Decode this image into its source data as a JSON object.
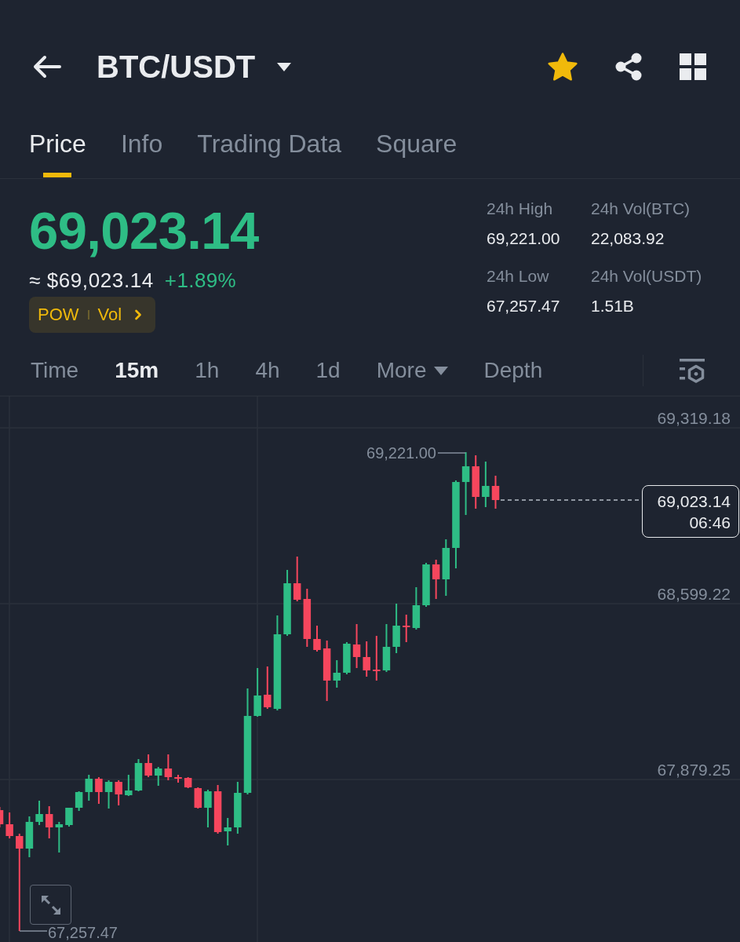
{
  "header": {
    "title": "BTC/USDT",
    "favorite": true
  },
  "tabs": [
    {
      "label": "Price",
      "selected": true
    },
    {
      "label": "Info",
      "selected": false
    },
    {
      "label": "Trading Data",
      "selected": false
    },
    {
      "label": "Square",
      "selected": false
    }
  ],
  "price": {
    "last": "69,023.14",
    "approx": "≈ $69,023.14",
    "change": "+1.89%",
    "rising": true,
    "tags": [
      "POW",
      "Vol"
    ]
  },
  "stats": [
    {
      "label": "24h High",
      "value": "69,221.00"
    },
    {
      "label": "24h Vol(BTC)",
      "value": "22,083.92"
    },
    {
      "label": "24h Low",
      "value": "67,257.47"
    },
    {
      "label": "24h Vol(USDT)",
      "value": "1.51B"
    }
  ],
  "intervals": [
    {
      "label": "Time",
      "kind": "option",
      "selected": false
    },
    {
      "label": "15m",
      "kind": "option",
      "selected": true
    },
    {
      "label": "1h",
      "kind": "option",
      "selected": false
    },
    {
      "label": "4h",
      "kind": "option",
      "selected": false
    },
    {
      "label": "1d",
      "kind": "option",
      "selected": false
    },
    {
      "label": "More",
      "kind": "dropdown",
      "selected": false
    },
    {
      "label": "Depth",
      "kind": "option",
      "selected": false
    }
  ],
  "chart": {
    "axis_labels": [
      "69,319.18",
      "68,599.22",
      "67,879.25"
    ],
    "high_label": "69,221.00",
    "low_label": "67,257.47",
    "last_price": "69,023.14",
    "countdown": "06:46"
  }
}
